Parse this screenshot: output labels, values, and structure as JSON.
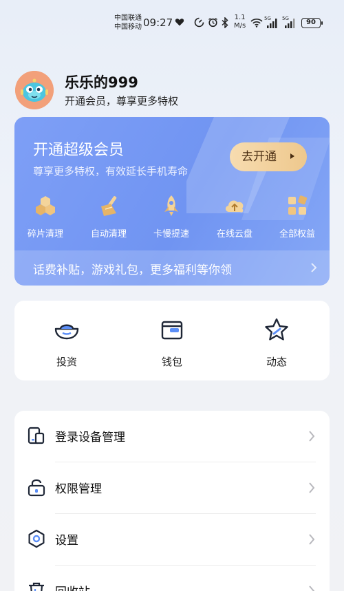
{
  "status_bar": {
    "carrier_1": "中国联通",
    "carrier_2": "中国移动",
    "time": "09:27",
    "net_speed_value": "1.1",
    "net_speed_unit": "M/s",
    "signal_tag": "5G",
    "battery": "90",
    "icons": [
      "heart-icon",
      "data-saver-icon",
      "alarm-icon",
      "bluetooth-icon",
      "wifi-icon",
      "signal-icon"
    ]
  },
  "profile": {
    "username": "乐乐的999",
    "subtitle": "开通会员，尊享更多特权",
    "avatar_color": "#f2a07a"
  },
  "vip": {
    "title": "开通超级会员",
    "subtitle": "尊享更多特权，有效延长手机寿命",
    "button": "去开通",
    "benefits": [
      {
        "label": "碎片清理",
        "icon": "fragments-icon"
      },
      {
        "label": "自动清理",
        "icon": "broom-icon"
      },
      {
        "label": "卡慢提速",
        "icon": "rocket-icon"
      },
      {
        "label": "在线云盘",
        "icon": "cloud-upload-icon"
      },
      {
        "label": "全部权益",
        "icon": "grid-icon"
      }
    ],
    "footer": "话费补贴，游戏礼包，更多福利等你领",
    "colors": {
      "card": "#7094f2",
      "button": "#eec88d"
    }
  },
  "quick": {
    "items": [
      {
        "label": "投资",
        "icon": "ingot-icon"
      },
      {
        "label": "钱包",
        "icon": "wallet-icon"
      },
      {
        "label": "动态",
        "icon": "star-icon"
      }
    ]
  },
  "menu": {
    "items": [
      {
        "label": "登录设备管理",
        "icon": "devices-icon"
      },
      {
        "label": "权限管理",
        "icon": "lock-icon"
      },
      {
        "label": "设置",
        "icon": "settings-icon"
      },
      {
        "label": "回收站",
        "icon": "trash-icon"
      }
    ]
  }
}
